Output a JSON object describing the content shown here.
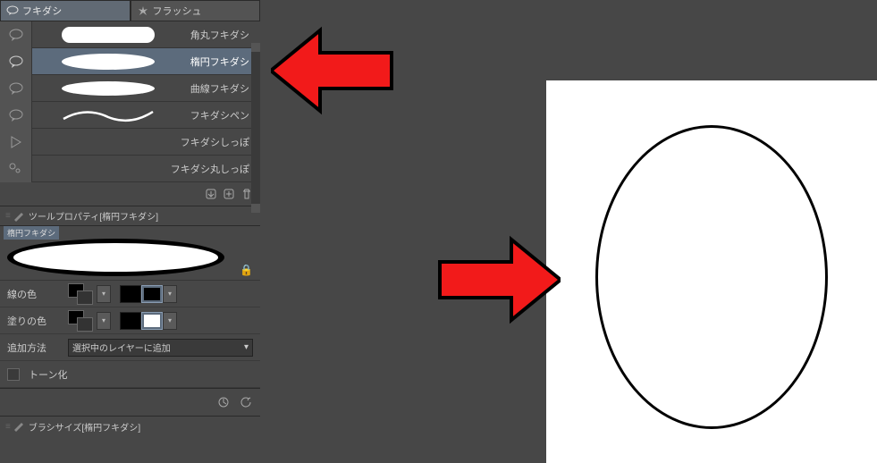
{
  "tabs": {
    "balloon": "フキダシ",
    "flash": "フラッシュ"
  },
  "subtools": [
    {
      "label": "角丸フキダシ",
      "shape": "rounded"
    },
    {
      "label": "楕円フキダシ",
      "shape": "ellipse"
    },
    {
      "label": "曲線フキダシ",
      "shape": "curve"
    },
    {
      "label": "フキダシペン",
      "shape": "pen"
    },
    {
      "label": "フキダシしっぽ",
      "shape": "tail"
    },
    {
      "label": "フキダシ丸しっぽ",
      "shape": "roundtail"
    }
  ],
  "toolprop": {
    "title": "ツールプロパティ[楕円フキダシ]",
    "preset_tab": "楕円フキダシ",
    "line_color_label": "線の色",
    "fill_color_label": "塗りの色",
    "add_method_label": "追加方法",
    "add_method_value": "選択中のレイヤーに追加",
    "tone_label": "トーン化"
  },
  "brushsize": {
    "title": "ブラシサイズ[楕円フキダシ]"
  },
  "colors": {
    "black": "#000000",
    "white": "#ffffff",
    "arrow_fill": "#f21a1a",
    "arrow_stroke": "#000000"
  }
}
